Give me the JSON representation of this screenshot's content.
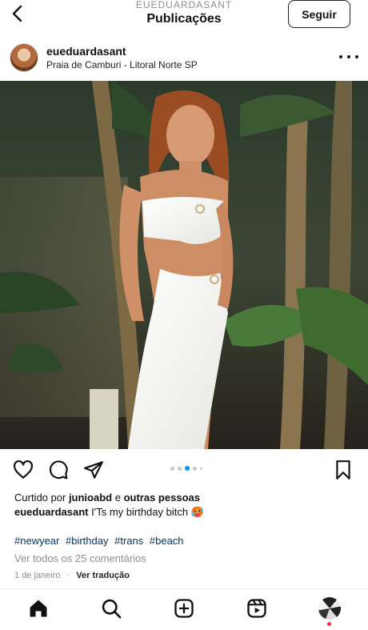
{
  "header": {
    "username": "EUEDUARDASANT",
    "title": "Publicações",
    "follow_label": "Seguir"
  },
  "post": {
    "username": "eueduardasant",
    "location": "Praia de Camburi - Litoral Norte SP",
    "carousel": {
      "count": 5,
      "active_index": 2
    },
    "liked_by_prefix": "Curtido por",
    "liked_by_user": "junioabd",
    "liked_by_joiner": "e",
    "liked_by_others": "outras pessoas",
    "caption_user": "eueduardasant",
    "caption_text": "I'Ts my birthday bitch 🥵",
    "hashtags": [
      "#newyear",
      "#birthday",
      "#trans",
      "#beach"
    ],
    "comments_link": "Ver todos os 25 comentários",
    "date": "1 de janeiro",
    "separator": "·",
    "translate_label": "Ver tradução"
  },
  "icons": {
    "back": "chevron-left-icon",
    "more": "more-horizontal-icon",
    "like": "heart-icon",
    "comment": "comment-icon",
    "share": "send-icon",
    "save": "bookmark-icon",
    "home": "home-icon",
    "search": "search-icon",
    "create": "plus-square-icon",
    "reels": "reels-icon"
  },
  "colors": {
    "link": "#00376b",
    "muted": "#8e8e8e",
    "carousel_active": "#0095f6",
    "notification": "#ff3040"
  }
}
